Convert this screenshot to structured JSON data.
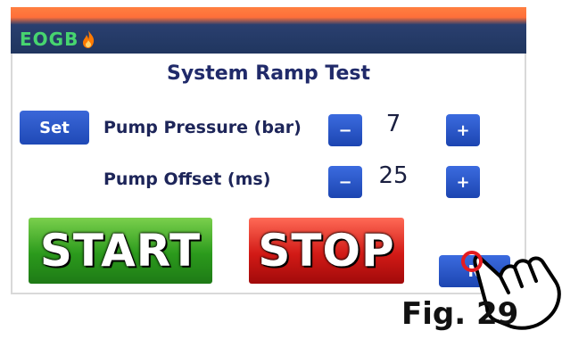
{
  "header": {
    "logo_text": "EOGB",
    "topbar_colors": {
      "accent": "#ff6f3a",
      "bar": "#20365f",
      "logo_text": "#47d56f"
    }
  },
  "main": {
    "title": "System Ramp Test",
    "set_label": "Set",
    "rows": [
      {
        "label": "Pump Pressure (bar)",
        "value": "7"
      },
      {
        "label": "Pump Offset (ms)",
        "value": "25"
      }
    ],
    "stepper": {
      "minus": "−",
      "plus": "+"
    },
    "start_label": "START",
    "stop_label": "STOP",
    "next_label": "N"
  },
  "icons": {
    "flame": "flame-icon",
    "pointer": "hand-pointer-icon"
  },
  "caption": "Fig. 29"
}
